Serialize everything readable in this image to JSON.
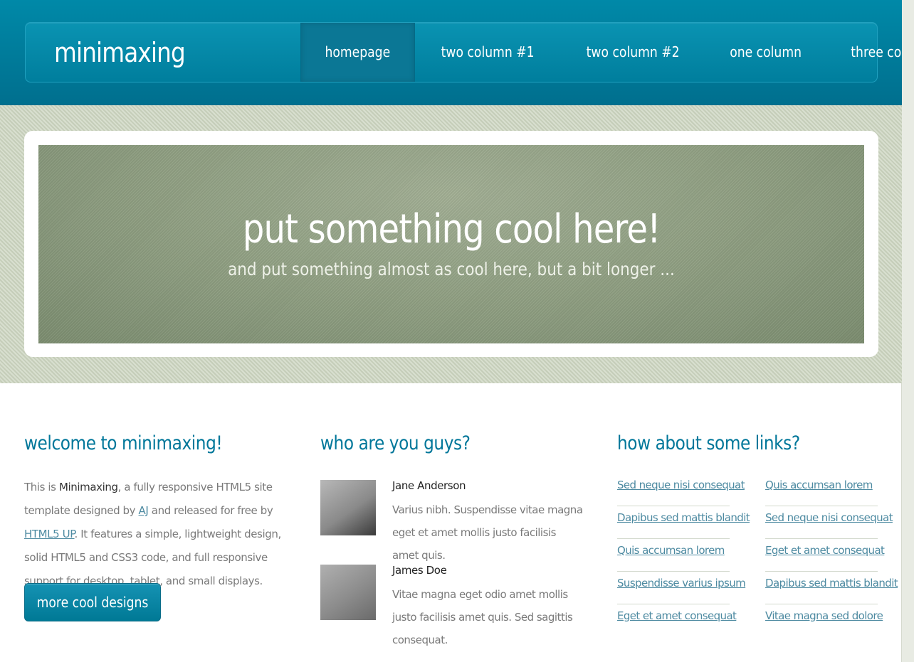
{
  "header": {
    "logo": "minimaxing",
    "nav": [
      {
        "label": "homepage",
        "active": true
      },
      {
        "label": "two column #1",
        "active": false
      },
      {
        "label": "two column #2",
        "active": false
      },
      {
        "label": "one column",
        "active": false
      },
      {
        "label": "three column",
        "active": false
      }
    ]
  },
  "banner": {
    "title": "put something cool here!",
    "subtitle": "and put something almost as cool here, but a bit longer ..."
  },
  "welcome": {
    "title": "welcome to minimaxing!",
    "text_1": "This is ",
    "brand": "Minimaxing",
    "text_2": ", a fully responsive HTML5 site template designed by ",
    "author_link": "AJ",
    "text_3": " and released for free by ",
    "html5up_link": "HTML5 UP",
    "text_4": ". It features a simple, lightweight design, solid HTML5 and CSS3 code, and full responsive support for desktop, tablet, and small displays.",
    "button": "more cool designs ..."
  },
  "people": {
    "title": "who are you guys?",
    "items": [
      {
        "name": "Jane Anderson",
        "text": "Varius nibh. Suspendisse vitae magna eget et amet mollis justo facilisis amet quis."
      },
      {
        "name": "James Doe",
        "text": "Vitae magna eget odio amet mollis justo facilisis amet quis. Sed sagittis consequat."
      }
    ]
  },
  "links": {
    "title": "how about some links?",
    "col1": [
      "Sed neque nisi consequat",
      "Dapibus sed mattis blandit",
      "Quis accumsan lorem",
      "Suspendisse varius ipsum",
      "Eget et amet consequat"
    ],
    "col2": [
      "Quis accumsan lorem",
      "Sed neque nisi consequat",
      "Eget et amet consequat",
      "Dapibus sed mattis blandit",
      "Vitae magna sed dolore"
    ]
  },
  "colors": {
    "header": "#007f9e",
    "accent": "#00779a",
    "link": "#4d8aa1",
    "banner": "#8d9d80"
  }
}
